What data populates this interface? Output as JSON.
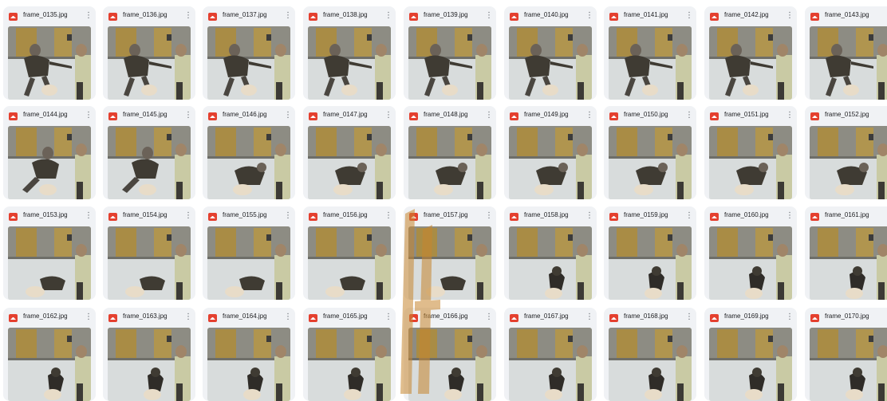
{
  "files": [
    {
      "name": "frame_0135.jpg",
      "stage": "standing"
    },
    {
      "name": "frame_0136.jpg",
      "stage": "standing"
    },
    {
      "name": "frame_0137.jpg",
      "stage": "standing"
    },
    {
      "name": "frame_0138.jpg",
      "stage": "standing"
    },
    {
      "name": "frame_0139.jpg",
      "stage": "standing"
    },
    {
      "name": "frame_0140.jpg",
      "stage": "standing"
    },
    {
      "name": "frame_0141.jpg",
      "stage": "standing"
    },
    {
      "name": "frame_0142.jpg",
      "stage": "standing"
    },
    {
      "name": "frame_0143.jpg",
      "stage": "standing"
    },
    {
      "name": "frame_0144.jpg",
      "stage": "leaning"
    },
    {
      "name": "frame_0145.jpg",
      "stage": "leaning"
    },
    {
      "name": "frame_0146.jpg",
      "stage": "falling"
    },
    {
      "name": "frame_0147.jpg",
      "stage": "falling"
    },
    {
      "name": "frame_0148.jpg",
      "stage": "falling"
    },
    {
      "name": "frame_0149.jpg",
      "stage": "falling"
    },
    {
      "name": "frame_0150.jpg",
      "stage": "falling"
    },
    {
      "name": "frame_0151.jpg",
      "stage": "falling"
    },
    {
      "name": "frame_0152.jpg",
      "stage": "falling"
    },
    {
      "name": "frame_0153.jpg",
      "stage": "down"
    },
    {
      "name": "frame_0154.jpg",
      "stage": "down"
    },
    {
      "name": "frame_0155.jpg",
      "stage": "down"
    },
    {
      "name": "frame_0156.jpg",
      "stage": "down"
    },
    {
      "name": "frame_0157.jpg",
      "stage": "down"
    },
    {
      "name": "frame_0158.jpg",
      "stage": "rising"
    },
    {
      "name": "frame_0159.jpg",
      "stage": "rising"
    },
    {
      "name": "frame_0160.jpg",
      "stage": "rising"
    },
    {
      "name": "frame_0161.jpg",
      "stage": "rising"
    },
    {
      "name": "frame_0162.jpg",
      "stage": "rising"
    },
    {
      "name": "frame_0163.jpg",
      "stage": "rising"
    },
    {
      "name": "frame_0164.jpg",
      "stage": "rising"
    },
    {
      "name": "frame_0165.jpg",
      "stage": "rising"
    },
    {
      "name": "frame_0166.jpg",
      "stage": "rising"
    },
    {
      "name": "frame_0167.jpg",
      "stage": "rising"
    },
    {
      "name": "frame_0168.jpg",
      "stage": "rising"
    },
    {
      "name": "frame_0169.jpg",
      "stage": "rising"
    },
    {
      "name": "frame_0170.jpg",
      "stage": "rising"
    }
  ],
  "icons": {
    "file": "image-file-icon",
    "more": "more-vert-icon"
  },
  "colors": {
    "file_icon": "#e4402f",
    "card_bg": "#f0f2f5",
    "accent_watermark": "#c7862f"
  }
}
